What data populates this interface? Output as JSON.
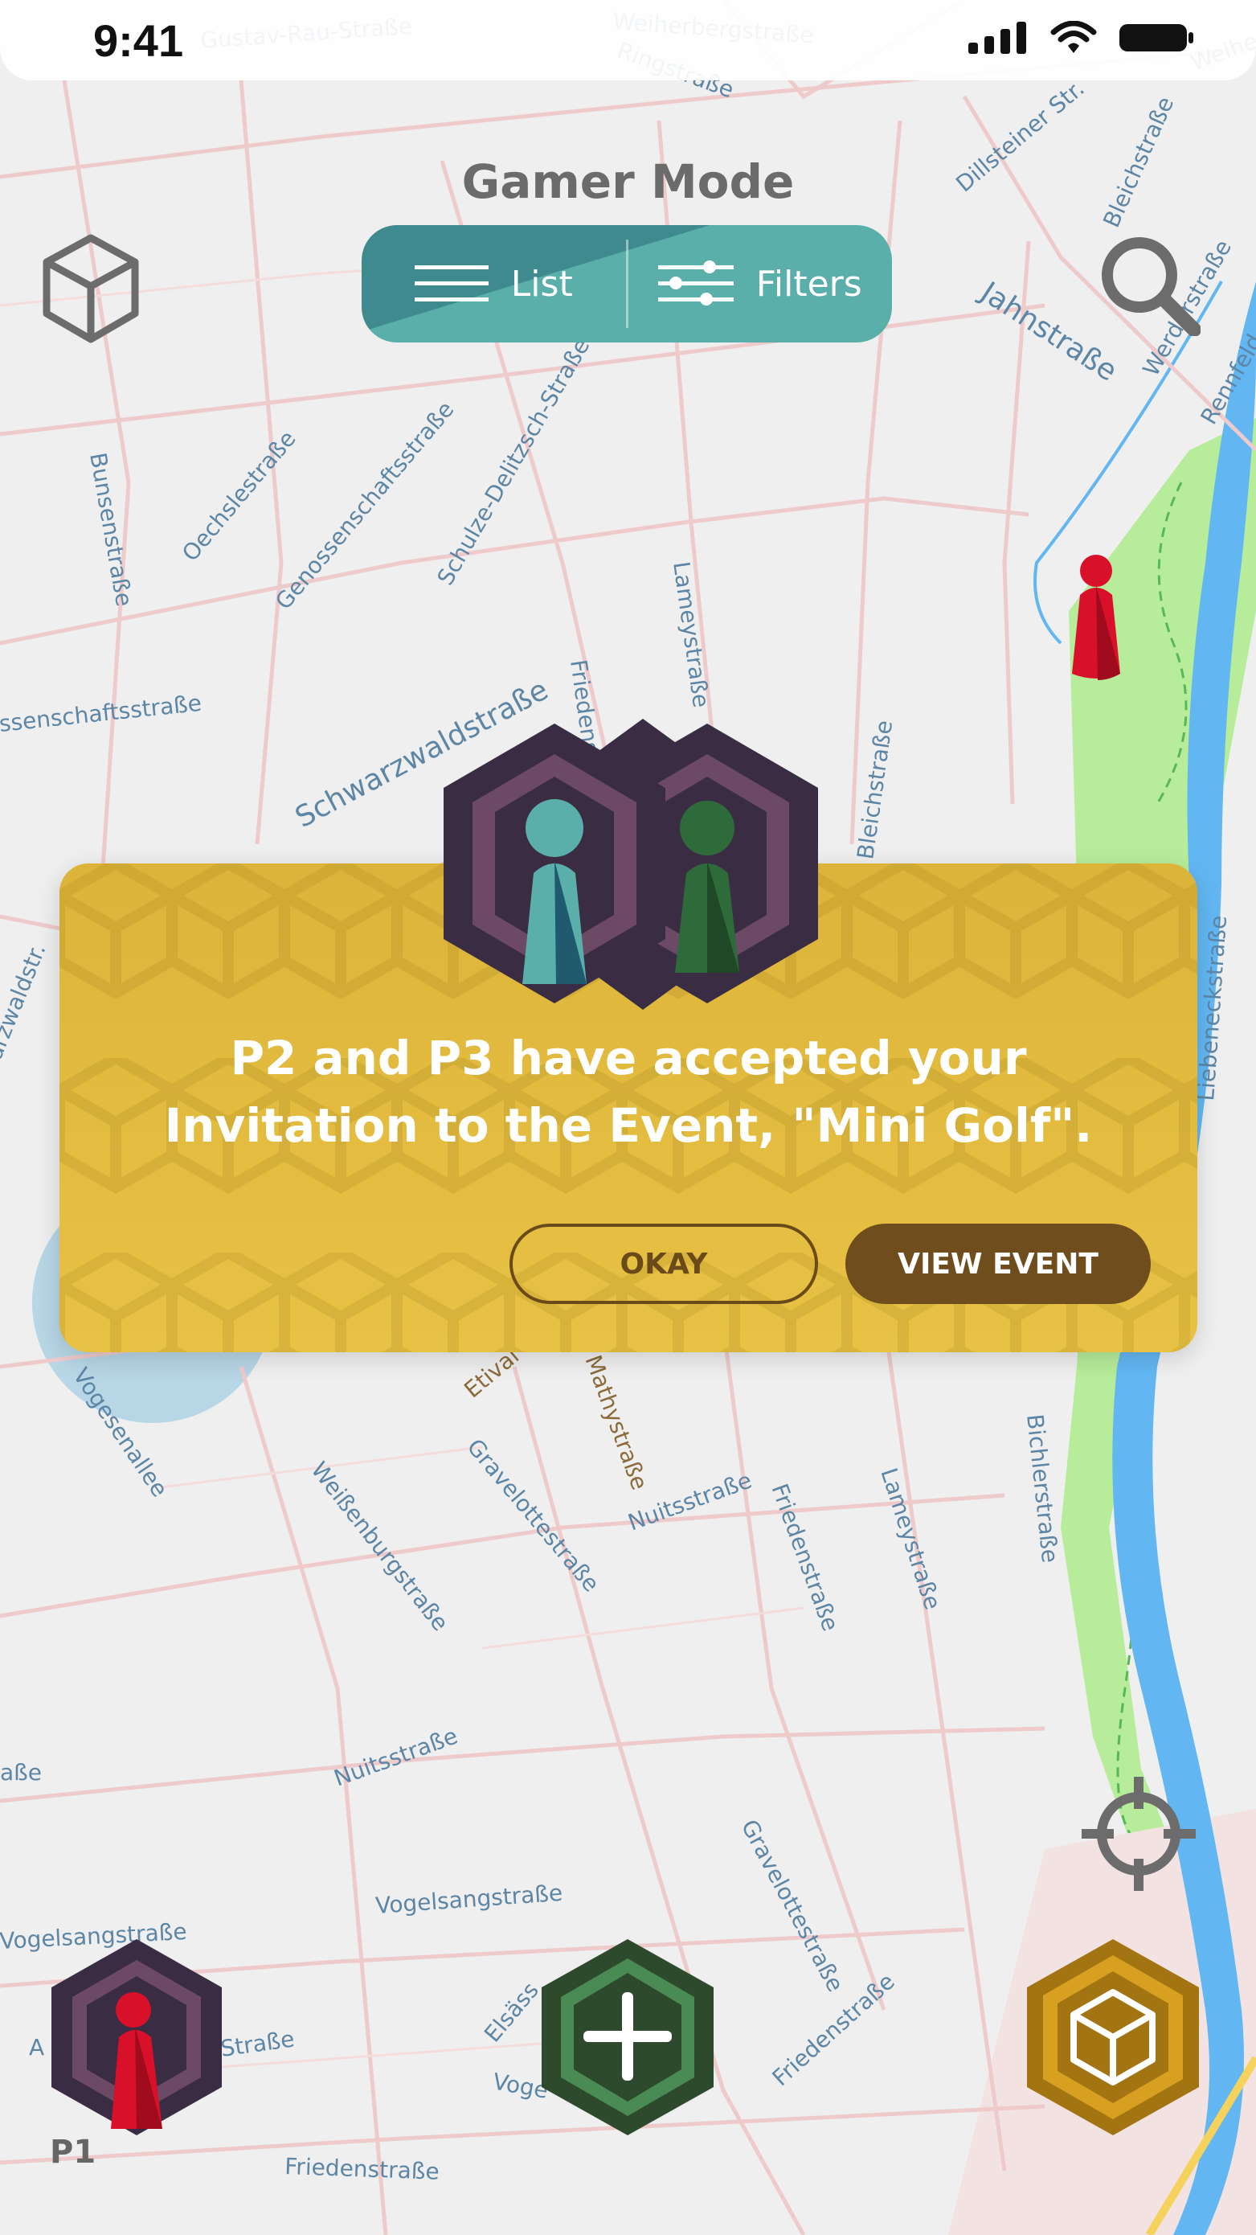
{
  "status_bar": {
    "time": "9:41"
  },
  "header": {
    "title": "Gamer Mode",
    "list_label": "List",
    "filters_label": "Filters"
  },
  "map": {
    "streets": [
      "Gustav-Rau-Straße",
      "Weiherbergstraße",
      "Ringstraße",
      "Dillsteiner Str.",
      "Bleichstraße",
      "Jahnstraße",
      "Werderstraße",
      "Rennfeld",
      "Bunsenstraße",
      "Oechslestraße",
      "Genossenschaftsstraße",
      "Schulze-Delitzsch-Straße",
      "Lameystraße",
      "Friedenstraße",
      "Schwarzwaldstraße",
      "ssenschaftsstraße",
      "Bleichstraße",
      "arzwaldstr.",
      "Liebeneckstraße",
      "Etival",
      "Mathystraße",
      "Vogesenallee",
      "Gravelottestraße",
      "Nuitsstraße",
      "Friedenstraße",
      "Lameystraße",
      "Weißenburgstraße",
      "Bichlerstraße",
      "aße",
      "Nuitsstraße",
      "Gravelottestraße",
      "Vogelsangstraße",
      "Vogelsangstraße",
      "Straße",
      "Elsäss",
      "Voge",
      "Friedenstraße",
      "Friedenstraße",
      "A",
      "Weihe"
    ]
  },
  "dialog": {
    "message_line1": "P2 and P3 have accepted your",
    "message_line2": "Invitation to the Event, \"Mini Golf\".",
    "okay_label": "OKAY",
    "view_event_label": "VIEW EVENT"
  },
  "bottom_bar": {
    "player_label": "P1"
  },
  "icons": {
    "cube": "cube-icon",
    "search": "search-icon",
    "locate": "crosshair-icon",
    "list": "list-icon",
    "filters": "sliders-icon",
    "add": "plus-icon",
    "player_pawn": "pawn-icon"
  },
  "colors": {
    "teal": "#5aafaa",
    "gold": "#e2bb3f",
    "brown": "#6f4d1c",
    "hex_purple": "#3a2c43",
    "hex_green": "#2e4a2c",
    "pawn_red": "#d8102a"
  }
}
